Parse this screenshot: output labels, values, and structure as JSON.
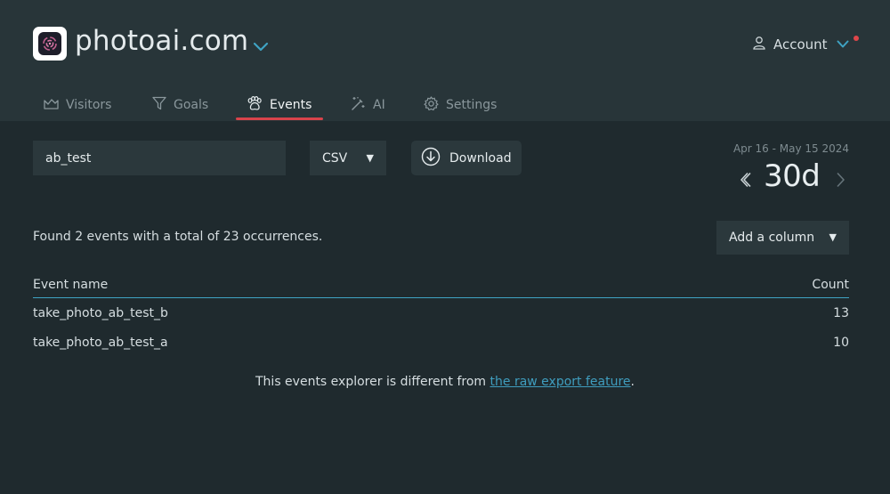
{
  "header": {
    "site_name": "photoai.com",
    "account_label": "Account"
  },
  "tabs": [
    {
      "label": "Visitors",
      "icon": "chart-area-icon"
    },
    {
      "label": "Goals",
      "icon": "funnel-icon"
    },
    {
      "label": "Events",
      "icon": "paw-icon"
    },
    {
      "label": "AI",
      "icon": "magic-wand-icon"
    },
    {
      "label": "Settings",
      "icon": "gear-icon"
    }
  ],
  "active_tab": "Events",
  "toolbar": {
    "filter_value": "ab_test",
    "format_value": "CSV",
    "download_label": "Download"
  },
  "period": {
    "date_range": "Apr 16 - May 15 2024",
    "value": "30d"
  },
  "summary": {
    "text": "Found 2 events with a total of 23 occurrences.",
    "add_column_label": "Add a column"
  },
  "table": {
    "columns": [
      "Event name",
      "Count"
    ],
    "rows": [
      {
        "name": "take_photo_ab_test_b",
        "count": "13"
      },
      {
        "name": "take_photo_ab_test_a",
        "count": "10"
      }
    ]
  },
  "footnote": {
    "prefix": "This events explorer is different from ",
    "link": "the raw export feature",
    "suffix": "."
  },
  "colors": {
    "background": "#1f2a2e",
    "header": "#283539",
    "accent_red": "#d9434b",
    "accent_blue": "#3fa3c3",
    "link": "#3f9dbe"
  }
}
